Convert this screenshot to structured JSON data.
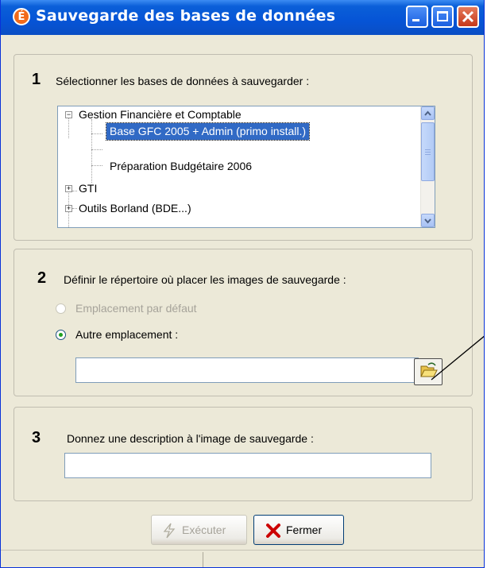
{
  "window": {
    "title": "Sauvegarde des bases de données",
    "app_icon_glyph": "É",
    "icon": "app-logo-icon"
  },
  "step1": {
    "number": "1",
    "label": "Sélectionner les bases de données à sauvegarder :",
    "tree": [
      {
        "label": "Gestion Financière et Comptable",
        "expander": "−",
        "level": 0,
        "selected": false
      },
      {
        "label": "Base GFC 2005 + Admin (primo install.)",
        "level": 1,
        "selected": true
      },
      {
        "label": "",
        "level": 1,
        "selected": false
      },
      {
        "label": "Préparation Budgétaire 2006",
        "level": 1,
        "selected": false
      },
      {
        "label": "GTI",
        "expander": "+",
        "level": 0,
        "selected": false
      },
      {
        "label": "Outils Borland (BDE...)",
        "expander": "+",
        "level": 0,
        "selected": false
      }
    ]
  },
  "step2": {
    "number": "2",
    "label": "Définir le répertoire où placer les images de sauvegarde :",
    "option_default": "Emplacement par défaut",
    "option_other": "Autre emplacement :",
    "path_value": ""
  },
  "step3": {
    "number": "3",
    "label": "Donnez une description à l'image de sauvegarde :",
    "description_value": ""
  },
  "buttons": {
    "execute": "Exécuter",
    "close": "Fermer"
  },
  "colors": {
    "titlebar": "#0654d6",
    "selection": "#316ac5",
    "close_x": "#cc0000"
  }
}
